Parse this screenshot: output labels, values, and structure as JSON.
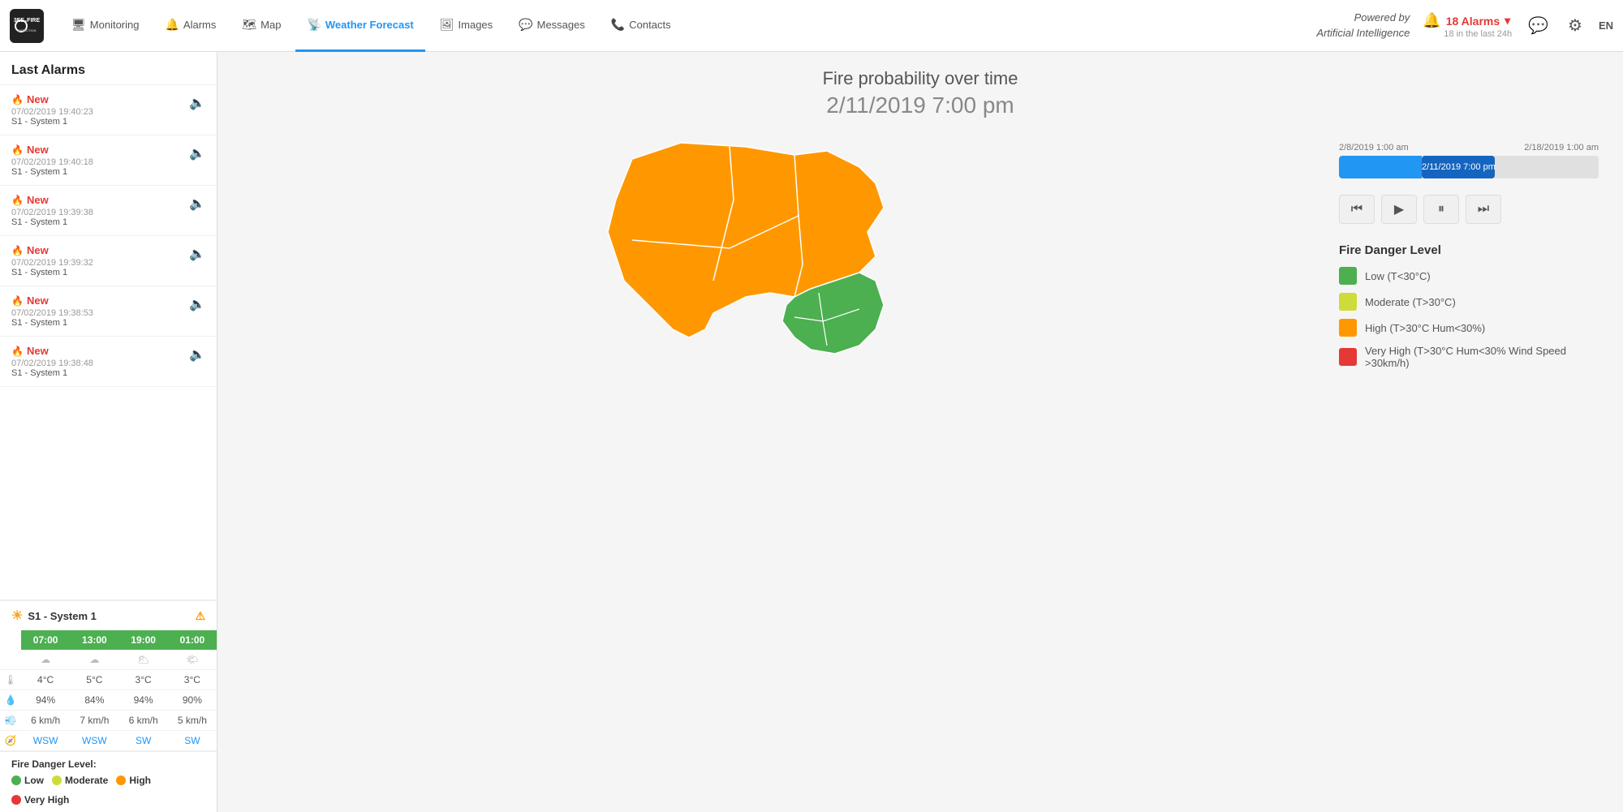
{
  "app": {
    "logo_line1": "3EE2FIRE",
    "logo_line2": "DETECTION",
    "lang": "EN"
  },
  "nav": {
    "items": [
      {
        "id": "monitoring",
        "label": "Monitoring",
        "icon": "🖥",
        "active": false
      },
      {
        "id": "alarms",
        "label": "Alarms",
        "icon": "🔔",
        "active": false
      },
      {
        "id": "map",
        "label": "Map",
        "icon": "🗺",
        "active": false
      },
      {
        "id": "weather",
        "label": "Weather Forecast",
        "icon": "📡",
        "active": true
      },
      {
        "id": "images",
        "label": "Images",
        "icon": "🖼",
        "active": false
      },
      {
        "id": "messages",
        "label": "Messages",
        "icon": "💬",
        "active": false
      },
      {
        "id": "contacts",
        "label": "Contacts",
        "icon": "📞",
        "active": false
      }
    ],
    "powered_label1": "Powered by",
    "powered_label2": "Artificial Intelligence",
    "alarms_label": "18 Alarms",
    "alarms_sub": "18 in the last 24h"
  },
  "sidebar": {
    "header": "Last Alarms",
    "alarms": [
      {
        "status": "New",
        "date": "07/02/2019 19:40:23",
        "system": "S1 - System 1"
      },
      {
        "status": "New",
        "date": "07/02/2019 19:40:18",
        "system": "S1 - System 1"
      },
      {
        "status": "New",
        "date": "07/02/2019 19:39:38",
        "system": "S1 - System 1"
      },
      {
        "status": "New",
        "date": "07/02/2019 19:39:32",
        "system": "S1 - System 1"
      },
      {
        "status": "New",
        "date": "07/02/2019 19:38:53",
        "system": "S1 - System 1"
      },
      {
        "status": "New",
        "date": "07/02/2019 19:38:48",
        "system": "S1 - System 1"
      }
    ]
  },
  "system_weather": {
    "title": "S1 - System 1",
    "columns": [
      "07:00",
      "13:00",
      "19:00",
      "01:00"
    ],
    "col_colors": [
      "#4caf50",
      "#4caf50",
      "#4caf50",
      "#4caf50"
    ],
    "temperatures": [
      "4°C",
      "5°C",
      "3°C",
      "3°C"
    ],
    "humidity": [
      "94%",
      "84%",
      "94%",
      "90%"
    ],
    "wind_speed": [
      "6 km/h",
      "7 km/h",
      "6 km/h",
      "5 km/h"
    ],
    "wind_dir": [
      "WSW",
      "WSW",
      "SW",
      "SW"
    ]
  },
  "fire_danger_bottom": {
    "label": "Fire Danger Level:",
    "items": [
      {
        "label": "Low",
        "color": "#4caf50"
      },
      {
        "label": "Moderate",
        "color": "#cddc39"
      },
      {
        "label": "High",
        "color": "#ff9800"
      },
      {
        "label": "Very High",
        "color": "#e53935"
      }
    ]
  },
  "main": {
    "chart_title": "Fire probability over time",
    "chart_date": "2/11/2019 7:00 pm",
    "timeline_start": "2/8/2019 1:00 am",
    "timeline_end": "2/18/2019 1:00 am",
    "timeline_current": "2/11/2019 7:00 pm",
    "timeline_pct": 32,
    "controls": {
      "rewind": "⏮",
      "play": "▶",
      "pause": "⏸",
      "forward": "⏭"
    },
    "legend_title": "Fire Danger Level",
    "legend": [
      {
        "label": "Low (T<30°C)",
        "color": "#4caf50"
      },
      {
        "label": "Moderate (T>30°C)",
        "color": "#cddc39"
      },
      {
        "label": "High (T>30°C Hum<30%)",
        "color": "#ff9800"
      },
      {
        "label": "Very High (T>30°C Hum<30% Wind Speed >30km/h)",
        "color": "#e53935"
      }
    ]
  }
}
